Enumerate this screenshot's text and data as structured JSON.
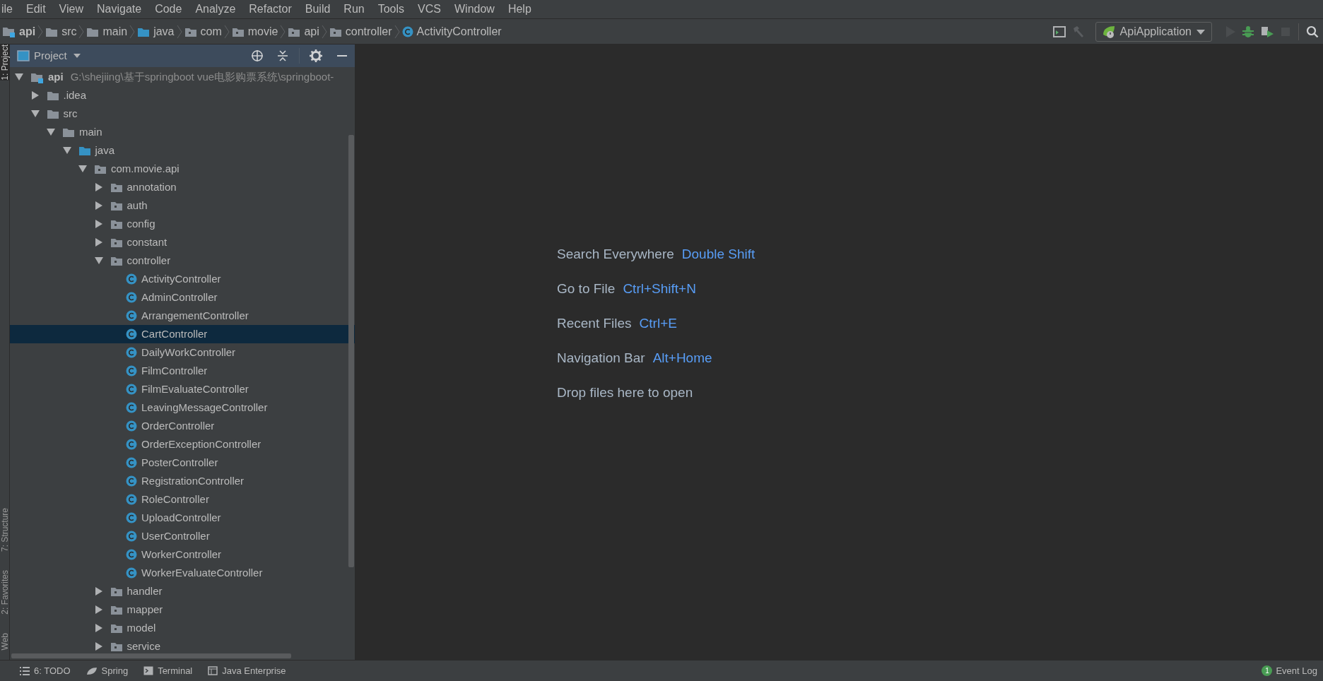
{
  "menu": [
    "ile",
    "Edit",
    "View",
    "Navigate",
    "Code",
    "Analyze",
    "Refactor",
    "Build",
    "Run",
    "Tools",
    "VCS",
    "Window",
    "Help"
  ],
  "breadcrumb": [
    {
      "label": "api",
      "kind": "module"
    },
    {
      "label": "src",
      "kind": "folder"
    },
    {
      "label": "main",
      "kind": "folder"
    },
    {
      "label": "java",
      "kind": "source"
    },
    {
      "label": "com",
      "kind": "package"
    },
    {
      "label": "movie",
      "kind": "package"
    },
    {
      "label": "api",
      "kind": "package"
    },
    {
      "label": "controller",
      "kind": "package"
    },
    {
      "label": "ActivityController",
      "kind": "class"
    }
  ],
  "run_config": "ApiApplication",
  "side_tabs_top": [
    {
      "label": "1: Project",
      "selected": true
    }
  ],
  "side_tabs_bottom": [
    {
      "label": "7: Structure",
      "selected": false
    },
    {
      "label": "2: Favorites",
      "selected": false
    },
    {
      "label": "Web",
      "selected": false
    }
  ],
  "project_panel": {
    "title": "Project",
    "tree": [
      {
        "label": "api",
        "path": "G:\\shejiing\\基于springboot vue电影购票系统\\springboot-",
        "kind": "module",
        "expanded": true,
        "selected": false,
        "children": [
          {
            "label": ".idea",
            "kind": "folder",
            "expanded": false,
            "selected": false
          },
          {
            "label": "src",
            "kind": "folder",
            "expanded": true,
            "selected": false,
            "children": [
              {
                "label": "main",
                "kind": "folder",
                "expanded": true,
                "selected": false,
                "children": [
                  {
                    "label": "java",
                    "kind": "source",
                    "expanded": true,
                    "selected": false,
                    "children": [
                      {
                        "label": "com.movie.api",
                        "kind": "package",
                        "expanded": true,
                        "selected": false,
                        "children": [
                          {
                            "label": "annotation",
                            "kind": "package",
                            "expanded": false,
                            "selected": false
                          },
                          {
                            "label": "auth",
                            "kind": "package",
                            "expanded": false,
                            "selected": false
                          },
                          {
                            "label": "config",
                            "kind": "package",
                            "expanded": false,
                            "selected": false
                          },
                          {
                            "label": "constant",
                            "kind": "package",
                            "expanded": false,
                            "selected": false
                          },
                          {
                            "label": "controller",
                            "kind": "package",
                            "expanded": true,
                            "selected": false,
                            "children": [
                              {
                                "label": "ActivityController",
                                "kind": "class",
                                "selected": false
                              },
                              {
                                "label": "AdminController",
                                "kind": "class",
                                "selected": false
                              },
                              {
                                "label": "ArrangementController",
                                "kind": "class",
                                "selected": false
                              },
                              {
                                "label": "CartController",
                                "kind": "class",
                                "selected": true
                              },
                              {
                                "label": "DailyWorkController",
                                "kind": "class",
                                "selected": false
                              },
                              {
                                "label": "FilmController",
                                "kind": "class",
                                "selected": false
                              },
                              {
                                "label": "FilmEvaluateController",
                                "kind": "class",
                                "selected": false
                              },
                              {
                                "label": "LeavingMessageController",
                                "kind": "class",
                                "selected": false
                              },
                              {
                                "label": "OrderController",
                                "kind": "class",
                                "selected": false
                              },
                              {
                                "label": "OrderExceptionController",
                                "kind": "class",
                                "selected": false
                              },
                              {
                                "label": "PosterController",
                                "kind": "class",
                                "selected": false
                              },
                              {
                                "label": "RegistrationController",
                                "kind": "class",
                                "selected": false
                              },
                              {
                                "label": "RoleController",
                                "kind": "class",
                                "selected": false
                              },
                              {
                                "label": "UploadController",
                                "kind": "class",
                                "selected": false
                              },
                              {
                                "label": "UserController",
                                "kind": "class",
                                "selected": false
                              },
                              {
                                "label": "WorkerController",
                                "kind": "class",
                                "selected": false
                              },
                              {
                                "label": "WorkerEvaluateController",
                                "kind": "class",
                                "selected": false
                              }
                            ]
                          },
                          {
                            "label": "handler",
                            "kind": "package",
                            "expanded": false,
                            "selected": false
                          },
                          {
                            "label": "mapper",
                            "kind": "package",
                            "expanded": false,
                            "selected": false
                          },
                          {
                            "label": "model",
                            "kind": "package",
                            "expanded": false,
                            "selected": false
                          },
                          {
                            "label": "service",
                            "kind": "package",
                            "expanded": false,
                            "selected": false
                          }
                        ]
                      }
                    ]
                  }
                ]
              }
            ]
          }
        ]
      }
    ]
  },
  "hints": [
    {
      "label": "Search Everywhere",
      "shortcut": "Double Shift"
    },
    {
      "label": "Go to File",
      "shortcut": "Ctrl+Shift+N"
    },
    {
      "label": "Recent Files",
      "shortcut": "Ctrl+E"
    },
    {
      "label": "Navigation Bar",
      "shortcut": "Alt+Home"
    },
    {
      "label": "Drop files here to open"
    }
  ],
  "bottom_tabs": [
    {
      "label": "6: TODO",
      "kind": "todo"
    },
    {
      "label": "Spring",
      "kind": "spring"
    },
    {
      "label": "Terminal",
      "kind": "terminal"
    },
    {
      "label": "Java Enterprise",
      "kind": "javaee"
    }
  ],
  "event_log": {
    "label": "Event Log",
    "count": "1"
  }
}
